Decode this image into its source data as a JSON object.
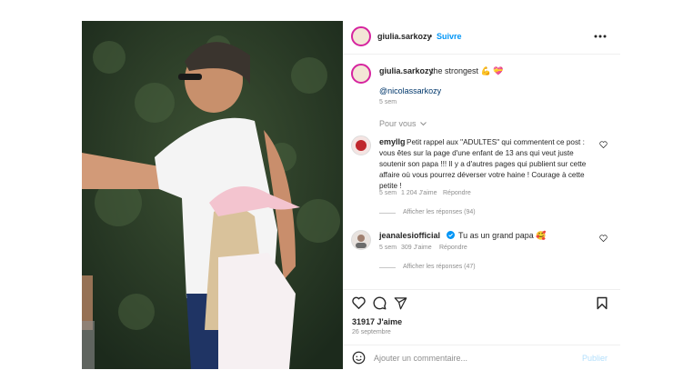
{
  "post_header": {
    "username": "giulia.sarkozy",
    "separator": "•",
    "follow_label": "Suivre"
  },
  "caption": {
    "username": "giulia.sarkozy",
    "text": "the strongest 💪 💝",
    "mention": "@nicolassarkozy",
    "time": "5 sem"
  },
  "filter_label": "Pour vous",
  "comments": [
    {
      "username": "emyllg",
      "text": "Petit rappel aux \"ADULTES\" qui commentent ce post : vous êtes sur la page d'une enfant de 13 ans qui veut juste soutenir son papa !!! Il y a d'autres pages qui publient sur cette affaire où vous pourrez déverser votre haine ! Courage à cette petite !",
      "time": "5 sem",
      "likes": "1 204 J'aime",
      "reply_label": "Répondre",
      "replies_label": "Afficher les réponses (94)"
    },
    {
      "username": "jeanalesiofficial",
      "text": "Tu as un grand papa 🥰",
      "time": "5 sem",
      "likes": "309 J'aime",
      "reply_label": "Répondre",
      "replies_label": "Afficher les réponses (47)"
    }
  ],
  "footer": {
    "likes": "31917 J'aime",
    "date": "26 septembre"
  },
  "add_comment": {
    "placeholder": "Ajouter un commentaire...",
    "publish_label": "Publier"
  },
  "colors": {
    "link": "#00376b",
    "accent": "#0095f6",
    "muted": "#8e8e8e",
    "story_ring": "#d6249f"
  },
  "icons": [
    "more-options-icon",
    "heart-icon",
    "comment-icon",
    "share-icon",
    "bookmark-icon",
    "emoji-icon",
    "verified-badge-icon",
    "chevron-down-icon"
  ]
}
